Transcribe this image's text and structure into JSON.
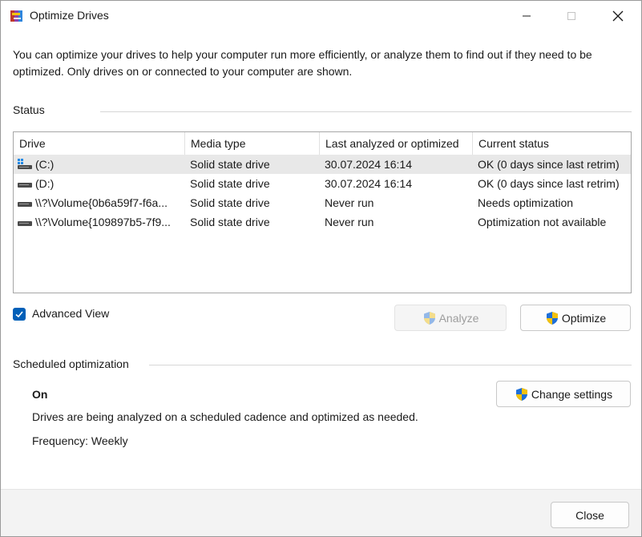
{
  "window": {
    "title": "Optimize Drives"
  },
  "intro": "You can optimize your drives to help your computer run more efficiently, or analyze them to find out if they need to be optimized. Only drives on or connected to your computer are shown.",
  "status": {
    "label": "Status",
    "columns": [
      "Drive",
      "Media type",
      "Last analyzed or optimized",
      "Current status"
    ],
    "rows": [
      {
        "drive": "(C:)",
        "media": "Solid state drive",
        "last": "30.07.2024 16:14",
        "status": "OK (0 days since last retrim)",
        "icon": "system-drive-icon",
        "selected": true
      },
      {
        "drive": "(D:)",
        "media": "Solid state drive",
        "last": "30.07.2024 16:14",
        "status": "OK (0 days since last retrim)",
        "icon": "drive-icon",
        "selected": false
      },
      {
        "drive": "\\\\?\\Volume{0b6a59f7-f6a...",
        "media": "Solid state drive",
        "last": "Never run",
        "status": "Needs optimization",
        "icon": "drive-icon",
        "selected": false
      },
      {
        "drive": "\\\\?\\Volume{109897b5-7f9...",
        "media": "Solid state drive",
        "last": "Never run",
        "status": "Optimization not available",
        "icon": "drive-icon",
        "selected": false
      }
    ]
  },
  "advanced_view": {
    "label": "Advanced View",
    "checked": true
  },
  "buttons": {
    "analyze": "Analyze",
    "optimize": "Optimize",
    "change_settings": "Change settings",
    "close": "Close"
  },
  "scheduled": {
    "label": "Scheduled optimization",
    "state": "On",
    "description": "Drives are being analyzed on a scheduled cadence and optimized as needed.",
    "frequency": "Frequency: Weekly"
  },
  "colors": {
    "accent": "#005fb8",
    "selection": "#e8e8e8",
    "footer": "#f3f3f3"
  }
}
